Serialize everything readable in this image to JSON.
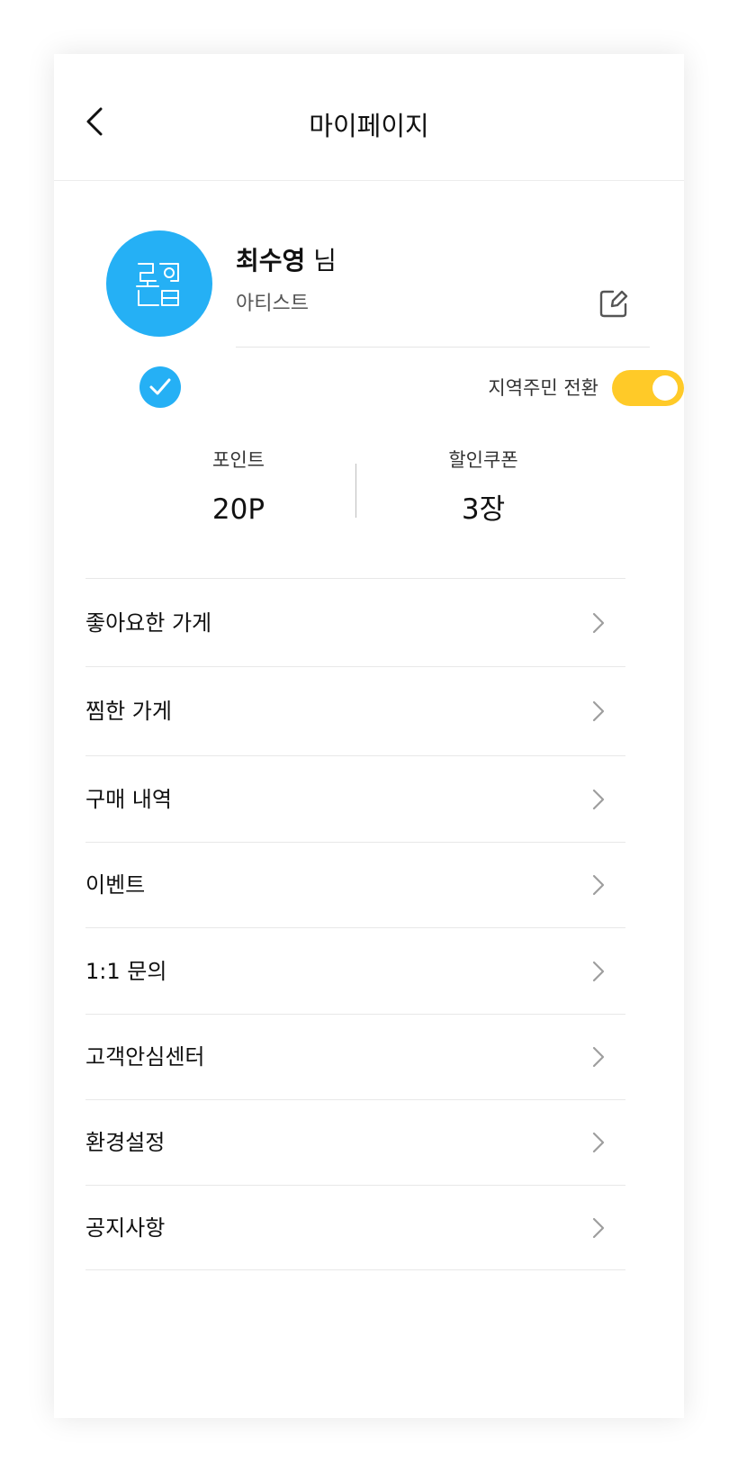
{
  "header": {
    "title": "마이페이지",
    "back_icon": "chevron-left-icon"
  },
  "profile": {
    "name": "최수영",
    "suffix": " 님",
    "role": "아티스트",
    "avatar_color": "#25b0f5",
    "edit_icon": "edit-icon",
    "verified_icon": "check-icon"
  },
  "toggle": {
    "label": "지역주민 전환",
    "state": "on",
    "color": "#ffca28"
  },
  "stats": {
    "points": {
      "label": "포인트",
      "value": "20P"
    },
    "coupons": {
      "label": "할인쿠폰",
      "value": "3장"
    }
  },
  "menu": [
    {
      "label": "좋아요한 가게"
    },
    {
      "label": "찜한 가게"
    },
    {
      "label": "구매 내역"
    },
    {
      "label": "이벤트"
    },
    {
      "label": "1:1 문의"
    },
    {
      "label": "고객안심센터"
    },
    {
      "label": "환경설정"
    },
    {
      "label": "공지사항"
    }
  ]
}
